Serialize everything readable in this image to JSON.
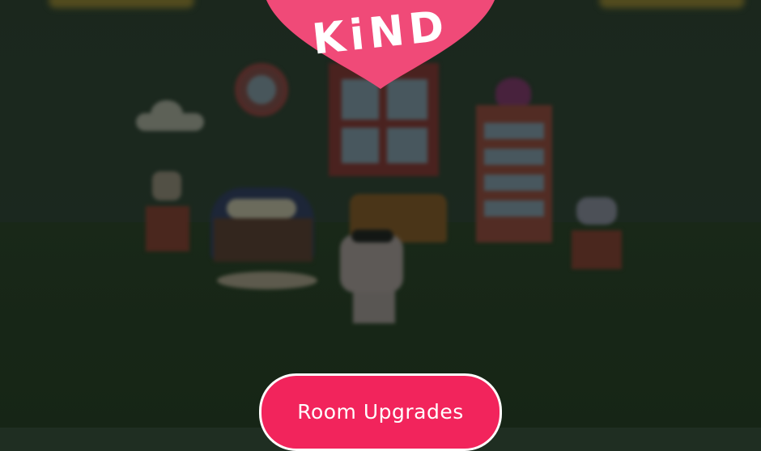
{
  "logo": {
    "text": "KiND",
    "heart_color": "#f04a78"
  },
  "buttons": {
    "room_upgrades": "Room Upgrades",
    "accent": "#f2245c"
  },
  "icons": [
    "clock-icon",
    "cloud-icon",
    "heart-logo-icon"
  ]
}
